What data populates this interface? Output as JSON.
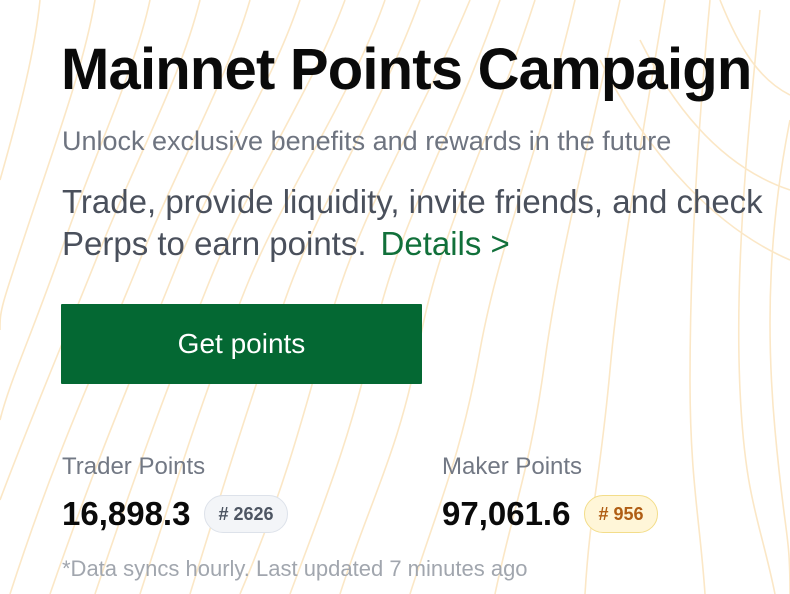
{
  "page": {
    "title": "Mainnet Points Campaign",
    "subtitle": "Unlock exclusive benefits and rewards in the future",
    "description_line1": "Trade, provide liquidity, invite friends, and check",
    "description_line2": "Perps to earn points.",
    "details_link": "Details >"
  },
  "cta": {
    "get_points_label": "Get points"
  },
  "points": {
    "trader": {
      "label": "Trader Points",
      "value": "16,898.3",
      "rank": "# 2626"
    },
    "maker": {
      "label": "Maker Points",
      "value": "97,061.6",
      "rank": "# 956"
    }
  },
  "footer": {
    "sync_note": "*Data syncs hourly. Last updated 7 minutes ago"
  },
  "colors": {
    "brand_green": "#046833",
    "link_green": "#11703a",
    "maker_badge_bg": "#fff6d8",
    "maker_badge_text": "#b05e14",
    "trader_badge_bg": "#f3f5f8",
    "background_pattern": "#fbe7c6"
  }
}
